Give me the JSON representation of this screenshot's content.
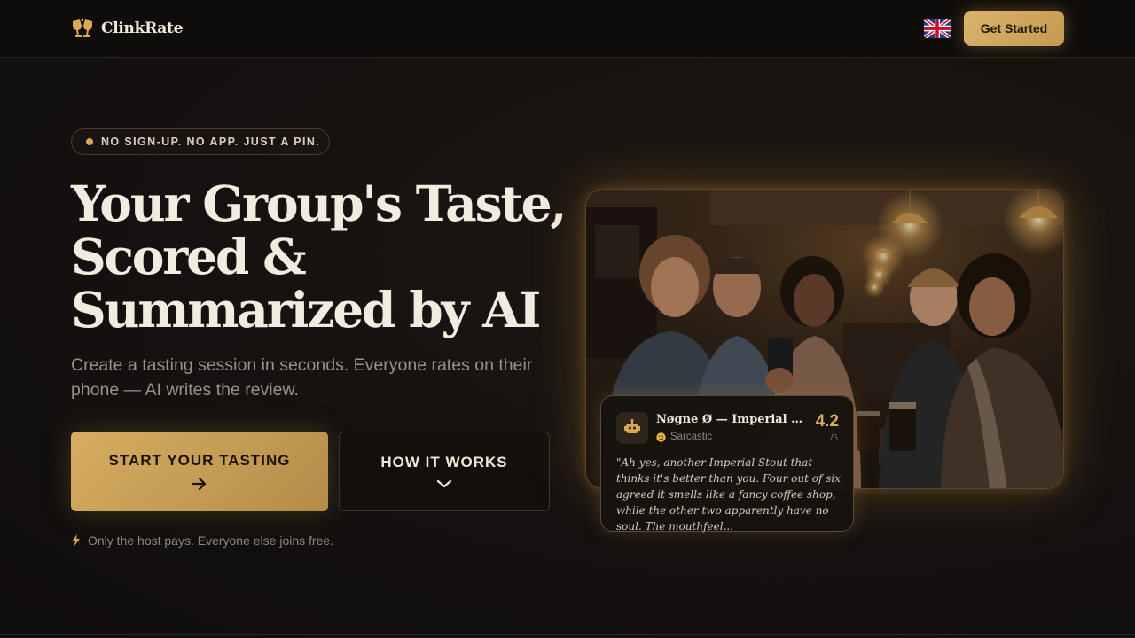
{
  "header": {
    "brand": "ClinkRate",
    "cta_label": "Get Started",
    "language_flag": "uk-flag-icon"
  },
  "hero": {
    "badge": "NO SIGN-UP. NO APP. JUST A PIN.",
    "title_lines": [
      "Your Group's Taste,",
      "Scored &",
      "Summarized by AI"
    ],
    "subtitle": "Create a tasting session in seconds. Everyone rates on their phone — AI writes the review.",
    "primary_cta": "START YOUR TASTING",
    "secondary_cta": "HOW IT WORKS",
    "note": "Only the host pays. Everyone else joins free."
  },
  "review_card": {
    "beer": "Nøgne Ø — Imperial Stout",
    "mood": "Sarcastic",
    "score": "4.2",
    "out_of": "/5",
    "quote": "\"Ah yes, another Imperial Stout that thinks it's better than you. Four out of six agreed it smells like a fancy coffee shop, while the other two apparently have no soul. The mouthfeel..."
  },
  "colors": {
    "accent": "#d7a955",
    "background": "#141110",
    "text": "#f2ebdf"
  }
}
